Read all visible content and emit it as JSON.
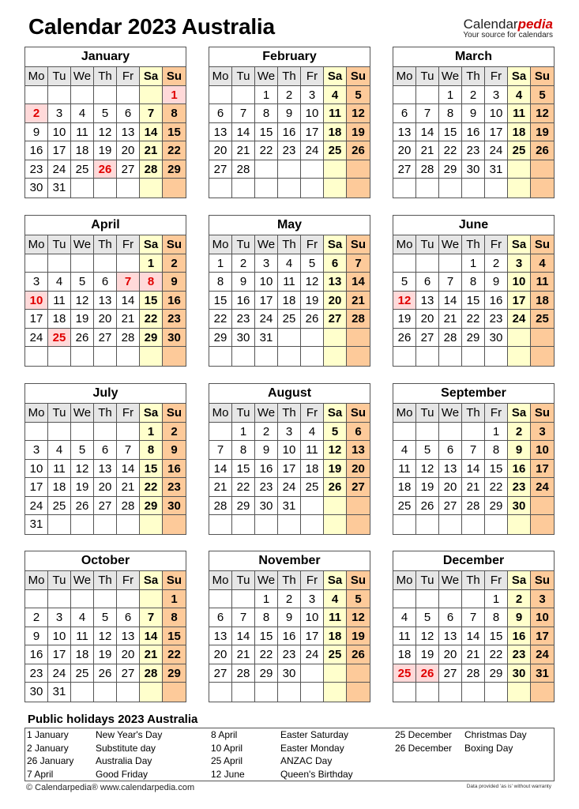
{
  "header": {
    "title": "Calendar 2023 Australia",
    "brand_main": "Calendar",
    "brand_accent": "pedia",
    "brand_tagline": "Your source for calendars"
  },
  "weekdays": [
    "Mo",
    "Tu",
    "We",
    "Th",
    "Fr",
    "Sa",
    "Su"
  ],
  "colors": {
    "saturday": "#ffffcc",
    "sunday": "#fdca9a",
    "holiday_bg": "#ffd9d9",
    "holiday_text": "#e00000",
    "header_bg": "#e6e6e6"
  },
  "months": [
    {
      "name": "January",
      "start": 6,
      "days": 31,
      "holidays": [
        1,
        2,
        26
      ]
    },
    {
      "name": "February",
      "start": 2,
      "days": 28,
      "holidays": []
    },
    {
      "name": "March",
      "start": 2,
      "days": 31,
      "holidays": []
    },
    {
      "name": "April",
      "start": 5,
      "days": 30,
      "holidays": [
        7,
        8,
        10,
        25
      ]
    },
    {
      "name": "May",
      "start": 0,
      "days": 31,
      "holidays": []
    },
    {
      "name": "June",
      "start": 3,
      "days": 30,
      "holidays": [
        12
      ]
    },
    {
      "name": "July",
      "start": 5,
      "days": 31,
      "holidays": []
    },
    {
      "name": "August",
      "start": 1,
      "days": 31,
      "holidays": []
    },
    {
      "name": "September",
      "start": 4,
      "days": 30,
      "holidays": []
    },
    {
      "name": "October",
      "start": 6,
      "days": 31,
      "holidays": []
    },
    {
      "name": "November",
      "start": 2,
      "days": 30,
      "holidays": []
    },
    {
      "name": "December",
      "start": 4,
      "days": 31,
      "holidays": [
        25,
        26
      ]
    }
  ],
  "holidays_section": {
    "title": "Public holidays 2023 Australia",
    "columns": [
      [
        {
          "date": "1 January",
          "name": "New Year's Day"
        },
        {
          "date": "2 January",
          "name": "Substitute day"
        },
        {
          "date": "26 January",
          "name": "Australia Day"
        },
        {
          "date": "7 April",
          "name": "Good Friday"
        }
      ],
      [
        {
          "date": "8 April",
          "name": "Easter Saturday"
        },
        {
          "date": "10 April",
          "name": "Easter Monday"
        },
        {
          "date": "25 April",
          "name": "ANZAC Day"
        },
        {
          "date": "12 June",
          "name": "Queen's Birthday"
        }
      ],
      [
        {
          "date": "25 December",
          "name": "Christmas Day"
        },
        {
          "date": "26 December",
          "name": "Boxing Day"
        }
      ]
    ]
  },
  "footer": {
    "copyright": "© Calendarpedia®   www.calendarpedia.com",
    "disclaimer": "Data provided 'as is' without warranty"
  }
}
